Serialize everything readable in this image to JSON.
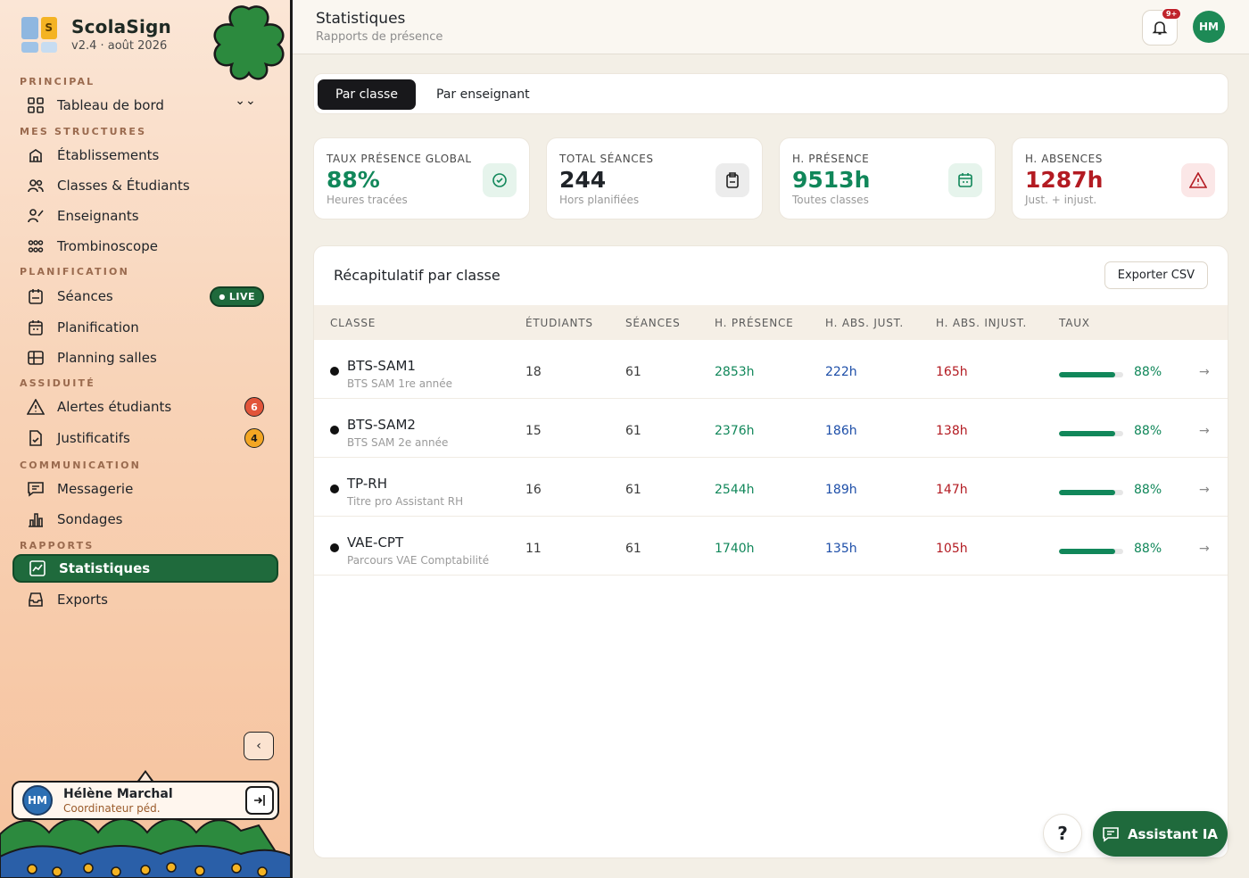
{
  "brand": {
    "name": "ScolaSign",
    "version": "v2.4 · août 2026",
    "logo_letter": "S"
  },
  "sidebar": {
    "sections": [
      {
        "label": "PRINCIPAL"
      },
      {
        "label": "MES STRUCTURES"
      },
      {
        "label": "PLANIFICATION"
      },
      {
        "label": "ASSIDUITÉ"
      },
      {
        "label": "COMMUNICATION"
      },
      {
        "label": "RAPPORTS"
      }
    ],
    "items": [
      {
        "label": "Tableau de bord",
        "icon": "dashboard-icon"
      },
      {
        "label": "Établissements",
        "icon": "building-icon"
      },
      {
        "label": "Classes & Étudiants",
        "icon": "users-icon"
      },
      {
        "label": "Enseignants",
        "icon": "teacher-icon"
      },
      {
        "label": "Trombinoscope",
        "icon": "grid-faces-icon"
      },
      {
        "label": "Séances",
        "icon": "clipboard-icon",
        "badge": "LIVE"
      },
      {
        "label": "Planification",
        "icon": "calendar-icon"
      },
      {
        "label": "Planning salles",
        "icon": "rooms-grid-icon"
      },
      {
        "label": "Alertes étudiants",
        "icon": "alert-triangle-icon",
        "badge": "6"
      },
      {
        "label": "Justificatifs",
        "icon": "document-check-icon",
        "badge": "4"
      },
      {
        "label": "Messagerie",
        "icon": "message-icon"
      },
      {
        "label": "Sondages",
        "icon": "bar-chart-icon"
      },
      {
        "label": "Statistiques",
        "icon": "line-chart-icon",
        "active": true
      },
      {
        "label": "Exports",
        "icon": "inbox-icon"
      }
    ],
    "collapse_label": "‹",
    "user": {
      "initials": "HM",
      "name": "Hélène Marchal",
      "role": "Coordinateur péd."
    }
  },
  "header": {
    "title": "Statistiques",
    "subtitle": "Rapports de présence",
    "notif_badge": "9+",
    "avatar_initials": "HM"
  },
  "tabs": [
    {
      "label": "Par classe",
      "active": true
    },
    {
      "label": "Par enseignant",
      "active": false
    }
  ],
  "kpis": [
    {
      "label": "TAUX PRÉSENCE GLOBAL",
      "value": "88%",
      "sub": "Heures tracées",
      "color": "#11875a",
      "icon": "check-circle-icon"
    },
    {
      "label": "TOTAL SÉANCES",
      "value": "244",
      "sub": "Hors planifiées",
      "color": "#1f2328",
      "icon": "clipboard-icon"
    },
    {
      "label": "H. PRÉSENCE",
      "value": "9513h",
      "sub": "Toutes classes",
      "color": "#11875a",
      "icon": "calendar-icon"
    },
    {
      "label": "H. ABSENCES",
      "value": "1287h",
      "sub": "Just. + injust.",
      "color": "#b31b22",
      "icon": "warning-icon"
    }
  ],
  "table": {
    "title": "Récapitulatif par classe",
    "export_label": "Exporter CSV",
    "columns": [
      "CLASSE",
      "ÉTUDIANTS",
      "SÉANCES",
      "H. PRÉSENCE",
      "H. ABS. JUST.",
      "H. ABS. INJUST.",
      "TAUX"
    ],
    "rows": [
      {
        "name": "BTS-SAM1",
        "desc": "BTS SAM 1re année",
        "students": "18",
        "sessions": "61",
        "presence": "2853h",
        "abs_just": "222h",
        "abs_injust": "165h",
        "rate": "88%",
        "rate_value": 0.88
      },
      {
        "name": "BTS-SAM2",
        "desc": "BTS SAM 2e année",
        "students": "15",
        "sessions": "61",
        "presence": "2376h",
        "abs_just": "186h",
        "abs_injust": "138h",
        "rate": "88%",
        "rate_value": 0.88
      },
      {
        "name": "TP-RH",
        "desc": "Titre pro Assistant RH",
        "students": "16",
        "sessions": "61",
        "presence": "2544h",
        "abs_just": "189h",
        "abs_injust": "147h",
        "rate": "88%",
        "rate_value": 0.88
      },
      {
        "name": "VAE-CPT",
        "desc": "Parcours VAE Comptabilité",
        "students": "11",
        "sessions": "61",
        "presence": "1740h",
        "abs_just": "135h",
        "abs_injust": "105h",
        "rate": "88%",
        "rate_value": 0.88
      }
    ]
  },
  "floating": {
    "help_label": "?",
    "ai_label": "Assistant IA"
  },
  "colors": {
    "accent": "#1f6a3c",
    "present": "#11875a",
    "justified": "#1d4ea8",
    "unjustified": "#b31b22"
  }
}
